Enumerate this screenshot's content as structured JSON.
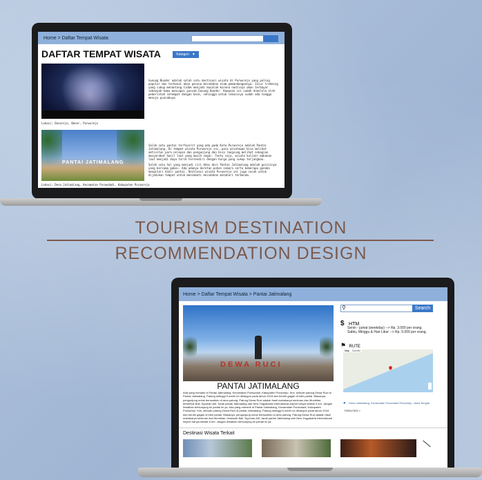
{
  "headline": {
    "line1": "TOURISM DESTINATION",
    "line2": "RECOMMENDATION DESIGN"
  },
  "laptop1": {
    "breadcrumb": "Home > Daftar Tempat Wisata",
    "title": "DAFTAR TEMPAT WISATA",
    "kategori": "Kategori",
    "entries": [
      {
        "desc": "Gunung Bunder adalah salah satu destinasi wisata di Purworejo yang paling populer dan terkenal akan pesona keindahan alam pemandangannya. Jalur trekking yang cukup menantang tidak menjadi masalah karena nantinya akan terbayar sebanyak kamu mencapai puncak Gunung Bunder. Kawasan ini sudah dikelola oleh pemerintah setempat dengan baik, sehingga untuk lokasinya sudah ada tangga menuju puncaknya.",
        "loc": "Lokasi: Donorejo, Bener, Purworejo"
      },
      {
        "desc": "Salah satu pantai terfavorit yang ada pada Kota Purworejo adalah Pantai Jatimalang. Di tempat wisata Purworejo ini, para wisatawan bisa melihat aktivitas para nelayan dan pengunjung dan bisa langsung melihat sebagian masyarakat hasil laut yang masih segar. Tentu saja, wisata kuliner makanan laut menjadi daya tarik tersendiri dengan harga yang cukup terjangkau.",
        "desc2": "Salah satu hal yang menjadi ciri khas dari Pantai Jatimalang adalah posisinya yang bersama gabai. Ada adanya deretan pohon cemara serta beberapa gazebo mengitari bibir pantai. Destinasi wisata Purworejo ini juga cocok untuk dijadikan tempat untuk menikmati keindahan matahari terbenam.",
        "loc": "Lokasi: Desa Jatimalang, Kecamatan Purwodadi, Kabupaten Purworejo",
        "sign": "PANTAI JATIMALANG"
      }
    ]
  },
  "laptop2": {
    "breadcrumb": "Home > Daftar Tempat Wisata > Pantai Jatimalang",
    "search_button": "Search",
    "title": "PANTAI JATIMALANG",
    "statue": "DEWA RUCI",
    "body": "Ada yang menarik di Pantai Jatimalang, Kecamatan Purwodadi, Kabupaten Purworejo. Kini, sebuah patung Dewa Ruci di Pantai Jatimalang. Patung setinggi 5 meter ini dibangun pada tahun 2018 dan berdiri gagah di bibir pantai. Biasanya, pengunjung untuk berswafoto di area patung. Patung Dewa Ruci adalah hasil mahakarya seniman dan Mumtilan, terbentuk Bali, Nyoman Alif. Jarak pantai Jatimalang dari New Yogyakarta International Airport hanya sekitar 5 km. Jangan lewatkan berkunjung ke pantai ini ya. Ada yang menarik di Pantai Jatimalang, Kecamatan Purwodadi, Kabupaten Purworejo. Kini, sebuah patung Dewa Ruci di pantai Jatimalang. Patung setinggi 6 meter ini dibangun pada tahun 2018 dan berdiri gagah di bibir pantai. Biasanya, pengunjung untuk berswafoto di area patung. Patung Dewa Ruci adalah hasil mahakarya seniman dari Mumtilan, berdarah Bali, Nyoman Alif. Jarak pantai Jatimalang dari New Yogyakarta International Airport hanya sekitar 5 km. Jangan lewatkan berkunjung ke pantai ini ya.",
    "htm_label": "HTM",
    "htm_lines": [
      "Senin - jumat (weekday) --> Rp. 3.000 per orang.",
      "Sabtu, Minggu & Hari Libur --> Rp. 5.000 per orang."
    ],
    "rute_label": "RUTE",
    "map_tabs": [
      "Map",
      "Satellite"
    ],
    "address": "Desa Jatimalang, Kecamatan Purwodadi Purworejo, Jawa Tengah",
    "fasilitas": "FASILITAS",
    "related_title": "Destinasi Wisata Terkait"
  }
}
